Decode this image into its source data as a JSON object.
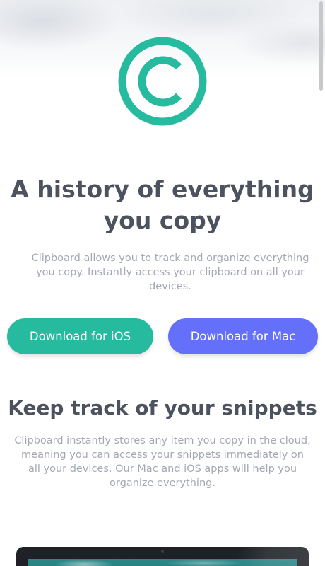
{
  "hero": {
    "title": "A history of everything you copy",
    "description": "Clipboard allows you to track and organize everything you copy. Instantly access your clipboard on all your devices.",
    "download_ios_label": "Download for iOS",
    "download_mac_label": "Download for Mac"
  },
  "snippets": {
    "title": "Keep track of your snippets",
    "description": "Clipboard instantly stores any item you copy in the cloud, meaning you can access your snippets immediately on all your devices. Our Mac and iOS apps will help you organize everything."
  },
  "icons": {
    "logo": "copyright-logo-icon"
  },
  "colors": {
    "accent_teal": "#26ba9f",
    "accent_blue": "#6470fa",
    "heading": "#4c535e",
    "body_text": "#a3a8b3"
  }
}
